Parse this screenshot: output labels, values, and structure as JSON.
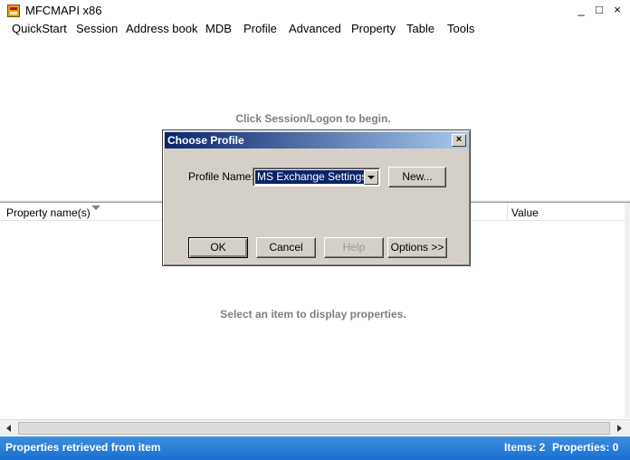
{
  "window": {
    "title": "MFCMAPI x86",
    "minimize": "_",
    "maximize": "□",
    "close": "×"
  },
  "menu": [
    {
      "label": "QuickStart"
    },
    {
      "label": "Session"
    },
    {
      "label": "Address book"
    },
    {
      "label": "MDB"
    },
    {
      "label": "Profile"
    },
    {
      "label": "Advanced"
    },
    {
      "label": "Property"
    },
    {
      "label": "Table"
    },
    {
      "label": "Tools"
    }
  ],
  "upper": {
    "hint": "Click Session/Logon to begin."
  },
  "property_list": {
    "columns": [
      "Property name(s)",
      "Value"
    ],
    "empty_hint": "Select an item to display properties."
  },
  "dialog": {
    "title": "Choose Profile",
    "close": "×",
    "profile_label": "Profile Name:",
    "profile_value": "MS Exchange Settings",
    "new_button": "New...",
    "ok_button": "OK",
    "cancel_button": "Cancel",
    "help_button": "Help",
    "options_button": "Options >>"
  },
  "status": {
    "left": "Properties retrieved from item",
    "items": "Items: 2",
    "properties": "Properties: 0"
  },
  "colors": {
    "status_bar": "#1a6fd1",
    "dialog_title": "#0a246a",
    "hint_text": "#7f7f7f"
  }
}
